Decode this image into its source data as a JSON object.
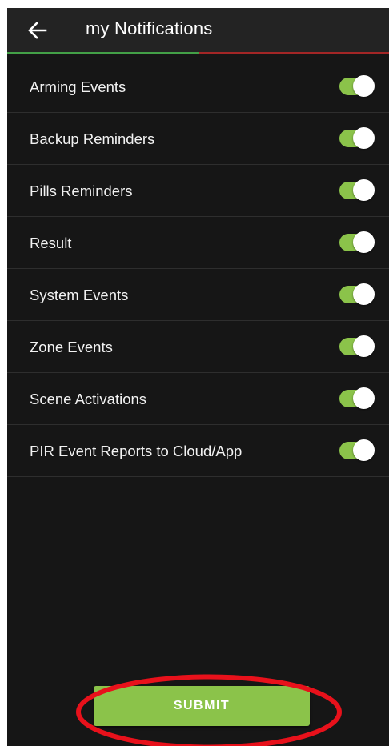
{
  "header": {
    "title": "my Notifications",
    "back_icon": "arrow-left-icon",
    "progress_fraction": 0.5
  },
  "notifications": [
    {
      "label": "Arming Events",
      "enabled": true
    },
    {
      "label": "Backup Reminders",
      "enabled": true
    },
    {
      "label": "Pills Reminders",
      "enabled": true
    },
    {
      "label": "Result",
      "enabled": true
    },
    {
      "label": "System Events",
      "enabled": true
    },
    {
      "label": "Zone Events",
      "enabled": true
    },
    {
      "label": "Scene Activations",
      "enabled": true
    },
    {
      "label": "PIR Event Reports to Cloud/App",
      "enabled": true
    }
  ],
  "submit": {
    "label": "SUBMIT"
  },
  "colors": {
    "background": "#161616",
    "appbar": "#232323",
    "accent_green": "#8bc34a",
    "toggle_on_track": "#8bc34a",
    "progress_done": "#43a047",
    "progress_rest": "#a32626",
    "highlight_ellipse": "#e8111b"
  }
}
